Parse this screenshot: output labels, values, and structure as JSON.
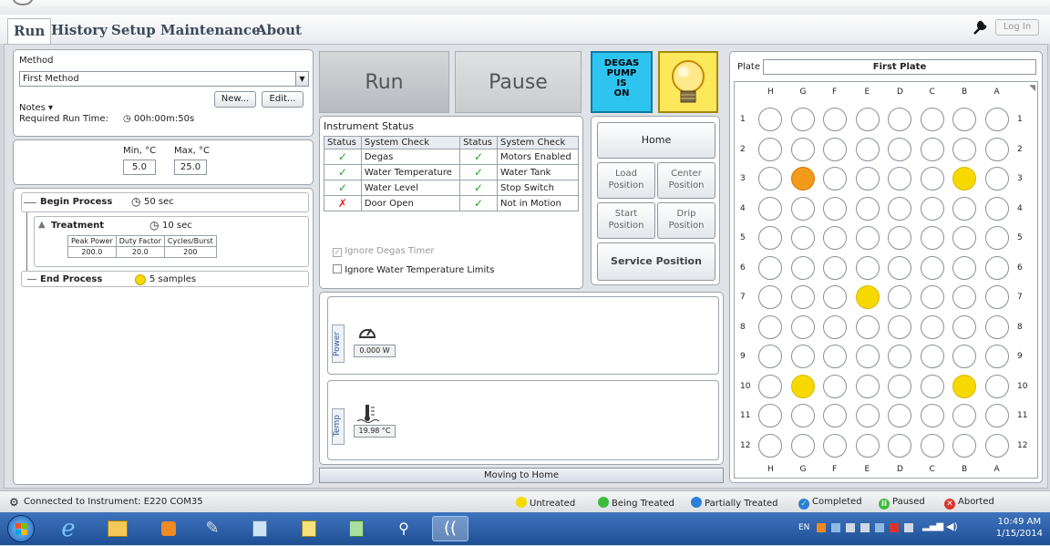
{
  "menu": {
    "tabs": [
      "Run",
      "History",
      "Setup",
      "Maintenance",
      "About"
    ],
    "login": "Log In"
  },
  "method": {
    "label": "Method",
    "selected": "First Method",
    "new_button": "New...",
    "edit_button": "Edit...",
    "notes_label": "Notes ▾",
    "required_time": "Required Run Time:",
    "required_time_value": "00h:00m:50s"
  },
  "temperature": {
    "min_label": "Min, °C",
    "max_label": "Max, °C",
    "min": "5.0",
    "max": "25.0"
  },
  "process": {
    "begin_label": "Begin Process",
    "begin_time": "50 sec",
    "treatment_label": "Treatment",
    "treatment_time": "10 sec",
    "headers": [
      "Peak Power",
      "Duty Factor",
      "Cycles/Burst"
    ],
    "values": [
      "200.0",
      "20.0",
      "200"
    ],
    "end_label": "End Process",
    "end_samples": "5 samples"
  },
  "controls": {
    "run": "Run",
    "pause": "Pause",
    "degas_lines": [
      "DEGAS",
      "PUMP",
      "IS",
      "ON"
    ]
  },
  "instrument_status": {
    "title": "Instrument Status",
    "col_status": "Status",
    "col_check": "System Check",
    "left": [
      {
        "status": "ok",
        "check": "Degas"
      },
      {
        "status": "ok",
        "check": "Water Temperature"
      },
      {
        "status": "ok",
        "check": "Water Level"
      },
      {
        "status": "fail",
        "check": "Door Open"
      }
    ],
    "right": [
      {
        "status": "ok",
        "check": "Motors Enabled"
      },
      {
        "status": "ok",
        "check": "Water Tank"
      },
      {
        "status": "ok",
        "check": "Stop Switch"
      },
      {
        "status": "ok",
        "check": "Not in Motion"
      }
    ],
    "ignore_degas": "Ignore Degas Timer",
    "ignore_water": "Ignore Water Temperature Limits"
  },
  "positions": {
    "home": "Home",
    "load_1": "Load",
    "load_2": "Position",
    "center_1": "Center",
    "center_2": "Position",
    "start_1": "Start",
    "start_2": "Position",
    "drip_1": "Drip",
    "drip_2": "Position",
    "service": "Service Position"
  },
  "readouts": {
    "power_tab": "Power",
    "power_value": "0.000 W",
    "temp_tab": "Temp",
    "temp_value": "19.98 °C",
    "moving": "Moving to Home"
  },
  "plate": {
    "label": "Plate",
    "name": "First Plate",
    "columns": [
      "H",
      "G",
      "F",
      "E",
      "D",
      "C",
      "B",
      "A"
    ],
    "rows": [
      "1",
      "2",
      "3",
      "4",
      "5",
      "6",
      "7",
      "8",
      "9",
      "10",
      "11",
      "12"
    ],
    "marked_wells": [
      {
        "row": "3",
        "col": "G",
        "state": "being-treated-orange"
      },
      {
        "row": "3",
        "col": "B",
        "state": "untreated"
      },
      {
        "row": "7",
        "col": "E",
        "state": "untreated"
      },
      {
        "row": "10",
        "col": "G",
        "state": "untreated"
      },
      {
        "row": "10",
        "col": "B",
        "state": "untreated"
      }
    ]
  },
  "statusbar": {
    "connection": "Connected to Instrument: E220 COM35",
    "legend": {
      "untreated": "Untreated",
      "being_treated": "Being Treated",
      "partially_treated": "Partially Treated",
      "completed": "Completed",
      "paused": "Paused",
      "aborted": "Aborted"
    }
  },
  "taskbar": {
    "lang": "EN",
    "time": "10:49 AM",
    "date": "1/15/2014"
  },
  "colors": {
    "degas": "#2ec4f0",
    "bulb": "#fde75b",
    "untreated": "#f7d900",
    "being_treated": "#3dbb3d",
    "partially_treated": "#2b7fd8",
    "paused": "#3dbb3d",
    "aborted": "#d9342b"
  }
}
